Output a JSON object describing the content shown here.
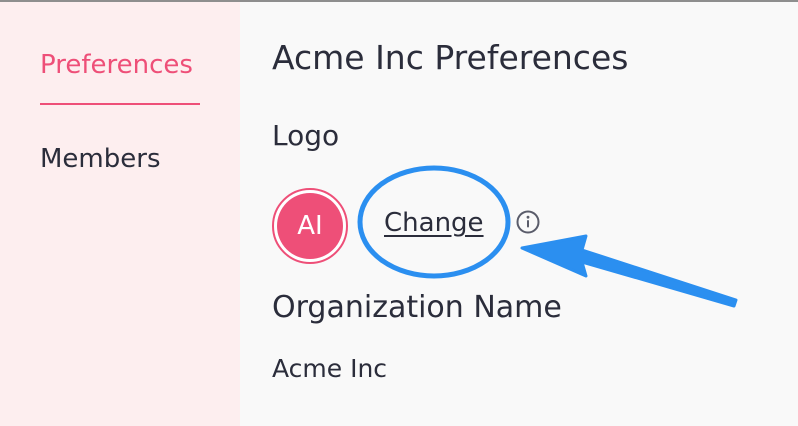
{
  "sidebar": {
    "items": [
      {
        "label": "Preferences",
        "active": true
      },
      {
        "label": "Members",
        "active": false
      }
    ]
  },
  "main": {
    "title": "Acme Inc Preferences",
    "logo": {
      "heading": "Logo",
      "avatar_initials": "AI",
      "change_label": "Change",
      "info_icon": "info-circle-icon"
    },
    "organization": {
      "heading": "Organization Name",
      "value": "Acme Inc"
    }
  },
  "colors": {
    "accent": "#ee4f78",
    "sidebar_bg": "#fdeeef",
    "text": "#2b2d3b",
    "annotation": "#2b8ff0"
  }
}
